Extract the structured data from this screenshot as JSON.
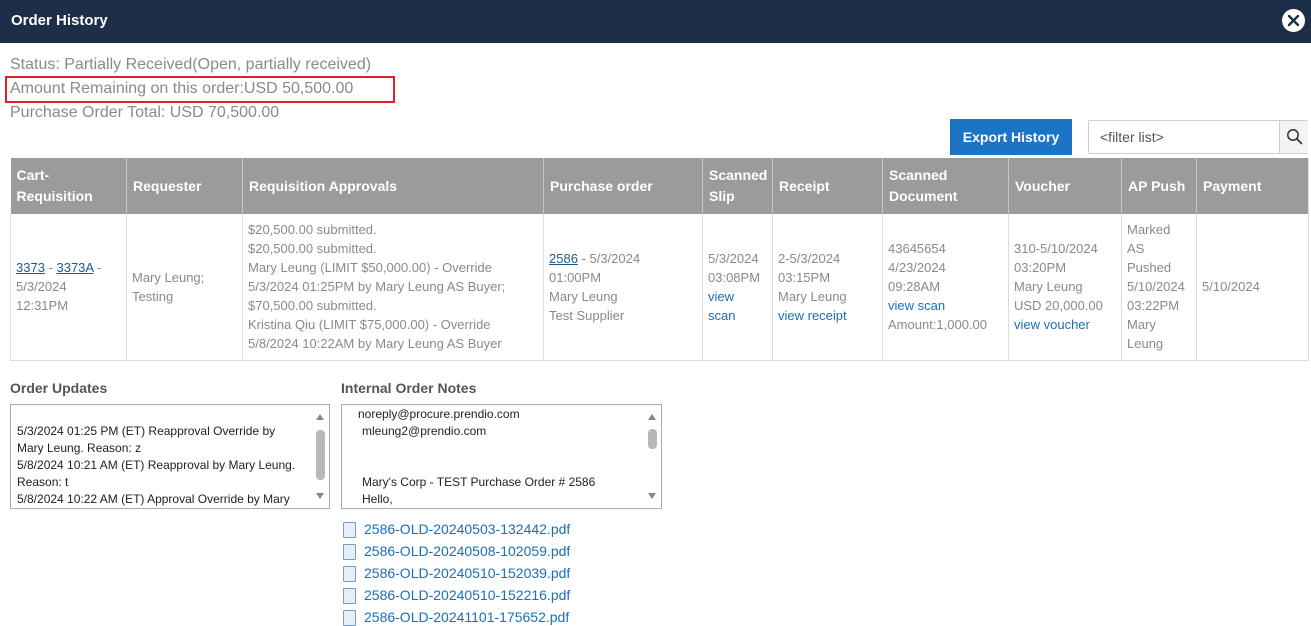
{
  "window": {
    "title": "Order History",
    "close_icon": "close-icon"
  },
  "summary": {
    "status": "Status: Partially Received(Open, partially received)",
    "amount_remaining": "Amount Remaining on this order:USD 50,500.00",
    "po_total": "Purchase Order Total: USD 70,500.00",
    "highlight_color": "#e11e2a"
  },
  "toolbar": {
    "export_label": "Export History",
    "filter_placeholder": "<filter list>",
    "search_icon": "search-icon"
  },
  "table": {
    "headers": [
      "Cart-Requisition",
      "Requester",
      "Requisition Approvals",
      "Purchase order",
      "Scanned Slip",
      "Receipt",
      "Scanned Document",
      "Voucher",
      "AP Push",
      "Payment"
    ],
    "row": {
      "req_link1": "3373",
      "req_sep1": " - ",
      "req_link2": "3373A",
      "req_sep2": " - ",
      "req_date": "5/3/2024",
      "req_time": "12:31PM",
      "requester": [
        "Mary Leung;",
        "Testing"
      ],
      "approvals": [
        "$20,500.00 submitted.",
        "$20,500.00 submitted.",
        "Mary Leung (LIMIT $50,000.00) - Override",
        "5/3/2024 01:25PM by Mary Leung AS Buyer;",
        "$70,500.00 submitted.",
        "Kristina Qiu (LIMIT $75,000.00) - Override",
        "5/8/2024 10:22AM by Mary Leung AS Buyer"
      ],
      "po_link": "2586",
      "po_date": " - 5/3/2024",
      "po_time": "01:00PM",
      "po_buyer": "Mary Leung",
      "po_supplier": "Test Supplier",
      "slip_date": "5/3/2024",
      "slip_time": "03:08PM",
      "slip_link1": "view",
      "slip_link2": "scan",
      "receipt_date": "2-5/3/2024",
      "receipt_time": "03:15PM",
      "receipt_user": "Mary Leung",
      "receipt_link": "view receipt",
      "doc_id": "43645654",
      "doc_date": "4/23/2024",
      "doc_time": "09:28AM",
      "doc_link": "view scan",
      "doc_amount": "Amount:1,000.00",
      "voucher_date": "310-5/10/2024",
      "voucher_time": "03:20PM",
      "voucher_user": "Mary Leung",
      "voucher_amount": "USD 20,000.00",
      "voucher_link": "view voucher",
      "ap_push": [
        "Marked",
        "AS",
        "Pushed",
        "5/10/2024",
        "03:22PM",
        "Mary",
        "Leung"
      ],
      "payment": "5/10/2024"
    }
  },
  "order_updates": {
    "label": "Order Updates",
    "lines": [
      "5/3/2024 01:25 PM (ET) Reapproval Override by",
      "Mary Leung. Reason: z",
      "5/8/2024 10:21 AM (ET) Reapproval by Mary Leung.",
      "Reason: t",
      "5/8/2024 10:22 AM (ET) Approval Override by Mary"
    ]
  },
  "internal_notes": {
    "label": "Internal Order Notes",
    "lines": [
      "noreply@procure.prendio.com",
      "mleung2@prendio.com",
      "",
      "",
      "Mary's Corp - TEST Purchase Order # 2586",
      "Hello,"
    ]
  },
  "attachments": [
    "2586-OLD-20240503-132442.pdf",
    "2586-OLD-20240508-102059.pdf",
    "2586-OLD-20240510-152039.pdf",
    "2586-OLD-20240510-152216.pdf",
    "2586-OLD-20241101-175652.pdf"
  ]
}
